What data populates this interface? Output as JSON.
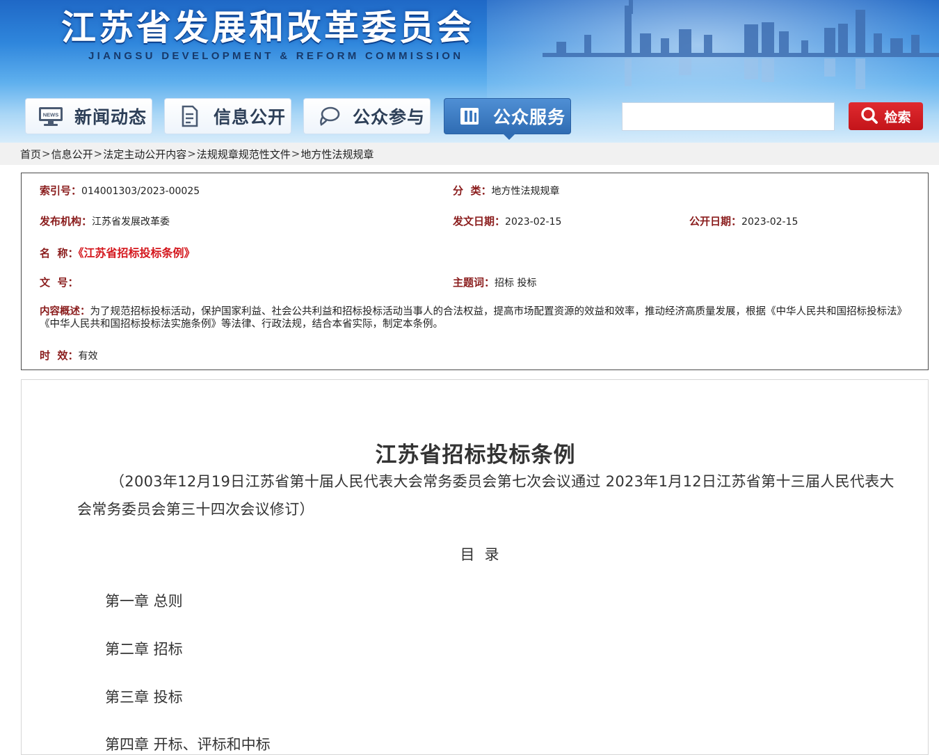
{
  "header": {
    "title": "江苏省发展和改革委员会",
    "subtitle": "JIANGSU DEVELOPMENT & REFORM COMMISSION"
  },
  "nav": {
    "tabs": [
      {
        "label": "新闻动态",
        "icon": "news-monitor-icon",
        "active": false
      },
      {
        "label": "信息公开",
        "icon": "document-icon",
        "active": false
      },
      {
        "label": "公众参与",
        "icon": "chat-bubble-icon",
        "active": false
      },
      {
        "label": "公众服务",
        "icon": "book-icon",
        "active": true
      }
    ]
  },
  "search": {
    "value": "",
    "button_label": "检索"
  },
  "breadcrumb": [
    "首页",
    "信息公开",
    "法定主动公开内容",
    "法规规章规范性文件",
    "地方性法规规章"
  ],
  "breadcrumb_sep": ">",
  "meta": {
    "index_label": "索引号",
    "index_value": "014001303/2023-00025",
    "category_label": "分  类",
    "category_value": "地方性法规规章",
    "publisher_label": "发布机构",
    "publisher_value": "江苏省发展改革委",
    "issue_date_label": "发文日期",
    "issue_date_value": "2023-02-15",
    "open_date_label": "公开日期",
    "open_date_value": "2023-02-15",
    "name_label": "名  称",
    "name_value": "《江苏省招标投标条例》",
    "doc_no_label": "文  号",
    "doc_no_value": "",
    "subject_label": "主题词",
    "subject_value": "招标 投标",
    "summary_label": "内容概述",
    "summary_value": "为了规范招标投标活动，保护国家利益、社会公共利益和招标投标活动当事人的合法权益，提高市场配置资源的效益和效率，推动经济高质量发展，根据《中华人民共和国招标投标法》《中华人民共和国招标投标法实施条例》等法律、行政法规，结合本省实际，制定本条例。",
    "validity_label": "时  效",
    "validity_value": "有效",
    "label_color": "#8a1c1c",
    "name_color": "#d4161c"
  },
  "article": {
    "title": "江苏省招标投标条例",
    "subtitle": "（2003年12月19日江苏省第十届人民代表大会常务委员会第七次会议通过  2023年1月12日江苏省第十三届人民代表大会常务委员会第三十四次会议修订）",
    "toc_title": "目录",
    "toc": [
      "第一章  总则",
      "第二章  招标",
      "第三章  投标",
      "第四章  开标、评标和中标"
    ]
  },
  "colors": {
    "accent_blue": "#2f6cb3",
    "search_red": "#c3141a"
  }
}
